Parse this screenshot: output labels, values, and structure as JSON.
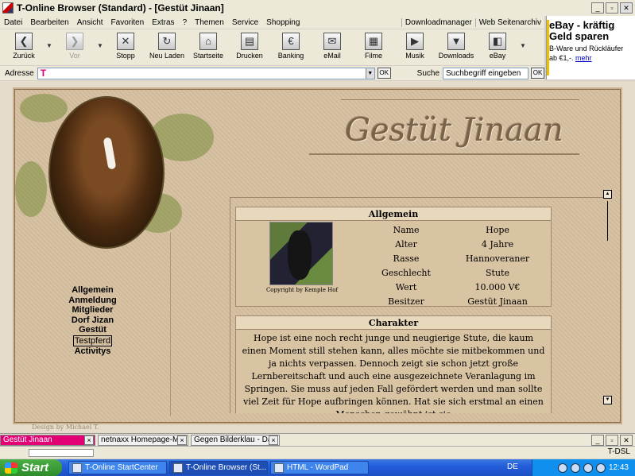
{
  "window": {
    "title": "T-Online Browser (Standard) - [Gestüt Jinaan]",
    "minimize": "_",
    "maximize": "▫",
    "close": "✕"
  },
  "menu": {
    "items": [
      "Datei",
      "Bearbeiten",
      "Ansicht",
      "Favoriten",
      "Extras",
      "?",
      "Themen",
      "Service",
      "Shopping"
    ],
    "right": [
      "Downloadmanager",
      "Web Seitenarchiv"
    ]
  },
  "toolbar": {
    "buttons": [
      {
        "label": "Zurück",
        "icon": "arrow-left-icon",
        "glyph": "❮"
      },
      {
        "label": "Vor",
        "icon": "arrow-right-icon",
        "glyph": "❯"
      },
      {
        "label": "Stopp",
        "icon": "stop-icon",
        "glyph": "✕"
      },
      {
        "label": "Neu Laden",
        "icon": "reload-icon",
        "glyph": "↻"
      },
      {
        "label": "Startseite",
        "icon": "home-icon",
        "glyph": "⌂"
      },
      {
        "label": "Drucken",
        "icon": "print-icon",
        "glyph": "▤"
      },
      {
        "label": "Banking",
        "icon": "euro-icon",
        "glyph": "€"
      },
      {
        "label": "eMail",
        "icon": "mail-icon",
        "glyph": "✉"
      },
      {
        "label": "Filme",
        "icon": "film-icon",
        "glyph": "▦"
      },
      {
        "label": "Musik",
        "icon": "music-icon",
        "glyph": "▶"
      },
      {
        "label": "Downloads",
        "icon": "download-icon",
        "glyph": "▼"
      },
      {
        "label": "eBay",
        "icon": "ebay-icon",
        "glyph": "◧"
      }
    ]
  },
  "address": {
    "label": "Adresse",
    "logo": "T",
    "ok": "OK",
    "search_label": "Suche",
    "search_value": "Suchbegriff eingeben",
    "search_ok": "OK"
  },
  "ad": {
    "headline": "eBay - kräftig Geld sparen",
    "text": "B-Ware und Rückläufer ab €1,-.",
    "link": "mehr"
  },
  "site": {
    "title": "Gestüt Jinaan",
    "nav": [
      "Allgemein",
      "Anmeldung",
      "Mitglieder",
      "Dorf Jizan",
      "Gestüt",
      "Testpferd",
      "Activitys"
    ],
    "active_nav": "Testpferd",
    "footer": "Design by Michael T.",
    "general": {
      "header": "Allgemein",
      "photo_caption": "Copyright by Kemple Hof",
      "rows": [
        {
          "k": "Name",
          "v": "Hope"
        },
        {
          "k": "Alter",
          "v": "4 Jahre"
        },
        {
          "k": "Rasse",
          "v": "Hannoveraner"
        },
        {
          "k": "Geschlecht",
          "v": "Stute"
        },
        {
          "k": "Wert",
          "v": "10.000 V€"
        },
        {
          "k": "Besitzer",
          "v": "Gestüt Jinaan"
        }
      ]
    },
    "character": {
      "header": "Charakter",
      "text": "Hope ist eine noch recht junge und neugierige Stute, die kaum einen Moment still stehen kann, alles möchte sie mitbekommen und ja nichts verpassen. Dennoch zeigt sie schon jetzt große Lernbereitschaft und auch eine ausgezeichnete Veranlagung im Springen. Sie muss auf jeden Fall gefördert werden und man sollte viel Zeit für Hope aufbringen können. Hat sie sich erstmal an einen Menschen gewöhnt ist sie"
    }
  },
  "tabs": [
    {
      "label": "Gestüt Jinaan",
      "active": true
    },
    {
      "label": "netnaxx Homepage-Mak...",
      "active": false
    },
    {
      "label": "Gegen Bilderklau - Das ...",
      "active": false
    }
  ],
  "status": {
    "connection": "T-DSL"
  },
  "taskbar": {
    "start": "Start",
    "tasks": [
      "T-Online StartCenter",
      "T-Online Browser (St...",
      "HTML - WordPad"
    ],
    "lang": "DE",
    "clock": "12:43"
  }
}
